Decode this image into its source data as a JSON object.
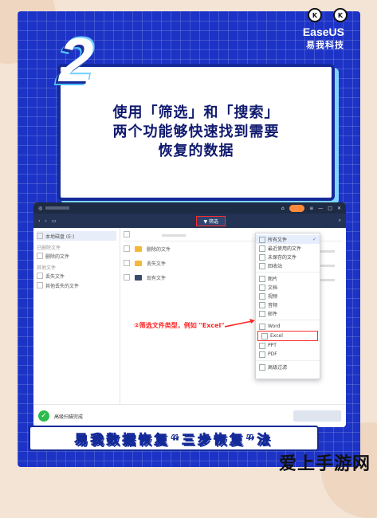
{
  "brand": {
    "en": "EaseUS",
    "cn": "易我科技"
  },
  "step_number": "2",
  "title_lines": [
    "使用「筛选」和「搜索」",
    "两个功能够快速找到需要",
    "恢复的数据"
  ],
  "app": {
    "filter_label": "筛选",
    "annotation": "②筛选文件类型，例如 \"Excel\"",
    "dropdown": {
      "items": [
        "所有文件",
        "最近使用的文件",
        "未保存的文件",
        "回收站",
        "图片",
        "文档",
        "视频",
        "音频",
        "邮件",
        "Word",
        "Excel",
        "PPT",
        "PDF",
        "高级过滤"
      ]
    },
    "sidebar": {
      "items": [
        {
          "label": "本地磁盘 (E:)"
        },
        {
          "label": "删除的文件"
        },
        {
          "label": "丢失文件"
        },
        {
          "label": "其他丢失的文件"
        }
      ],
      "groups": [
        "已删除文件",
        "其他文件"
      ]
    },
    "list_rows": [
      "删除的文件",
      "丢失文件",
      "现有文件"
    ],
    "status": {
      "line1": "高级扫描完成",
      "line2": ""
    }
  },
  "bottom_banner": "易我数据恢复“三步恢复”法",
  "watermark": "爱上手游网"
}
